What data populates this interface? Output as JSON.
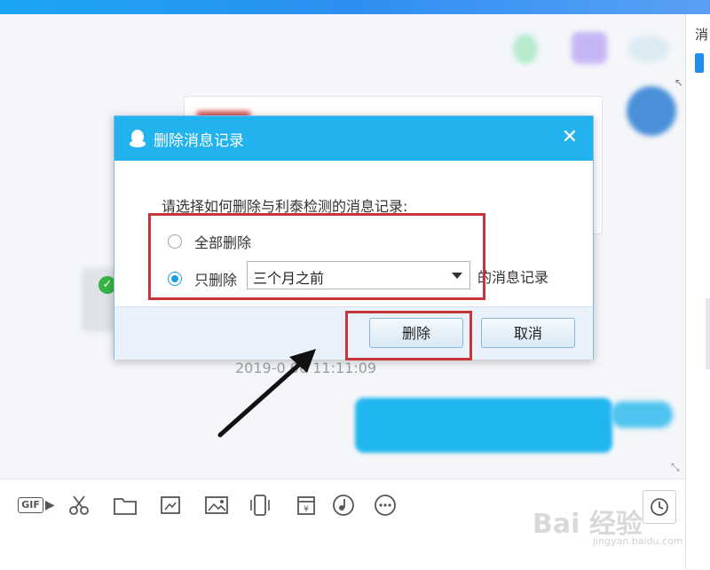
{
  "dialog": {
    "title": "删除消息记录",
    "prompt": "请选择如何删除与利泰检测的消息记录:",
    "options": [
      {
        "label": "全部删除",
        "checked": false
      },
      {
        "label": "只删除",
        "checked": true
      }
    ],
    "range_select": {
      "value": "三个月之前"
    },
    "suffix": "的消息记录",
    "delete_button": "删除",
    "cancel_button": "取消"
  },
  "chat": {
    "timestamp": "2019-0 06 11:11:09",
    "side_tab": "消"
  },
  "toolbar": {
    "gif_label": "GIF",
    "items": [
      "gif-icon",
      "scissors-icon",
      "folder-icon",
      "screenshot-icon",
      "image-icon",
      "vibrate-icon",
      "calendar-icon",
      "red-packet-icon",
      "music-icon",
      "more-icon"
    ]
  },
  "watermark": {
    "text": "Bai 经验",
    "sub": "jingyan.baidu.com"
  },
  "colors": {
    "title_bar": "#22b3ee",
    "highlight": "#c8353a",
    "accent": "#1f8ff0"
  }
}
